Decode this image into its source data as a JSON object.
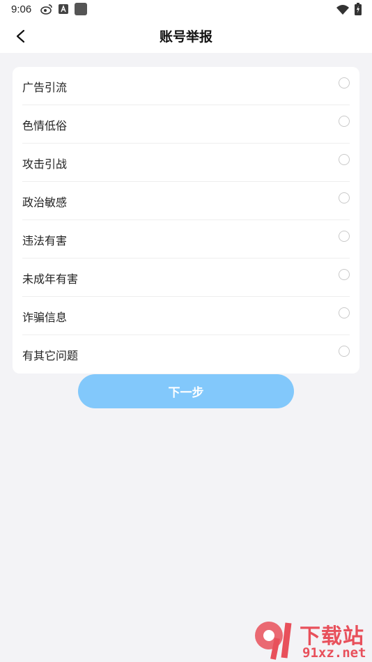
{
  "status_bar": {
    "time": "9:06",
    "icons_left": [
      "weibo-icon",
      "a-icon",
      "square-icon"
    ],
    "icons_right": [
      "wifi-icon",
      "battery-icon"
    ]
  },
  "header": {
    "title": "账号举报",
    "back_icon": "chevron-left-icon"
  },
  "report_options": [
    {
      "label": "广告引流",
      "selected": false
    },
    {
      "label": "色情低俗",
      "selected": false
    },
    {
      "label": "攻击引战",
      "selected": false
    },
    {
      "label": "政治敏感",
      "selected": false
    },
    {
      "label": "违法有害",
      "selected": false
    },
    {
      "label": "未成年有害",
      "selected": false
    },
    {
      "label": "诈骗信息",
      "selected": false
    },
    {
      "label": "有其它问题",
      "selected": false
    }
  ],
  "next_button": {
    "label": "下一步",
    "color": "#82c8fb",
    "enabled": false
  },
  "watermark": {
    "brand": "下载站",
    "domain": "91xz.net",
    "color": "#e8505b"
  }
}
